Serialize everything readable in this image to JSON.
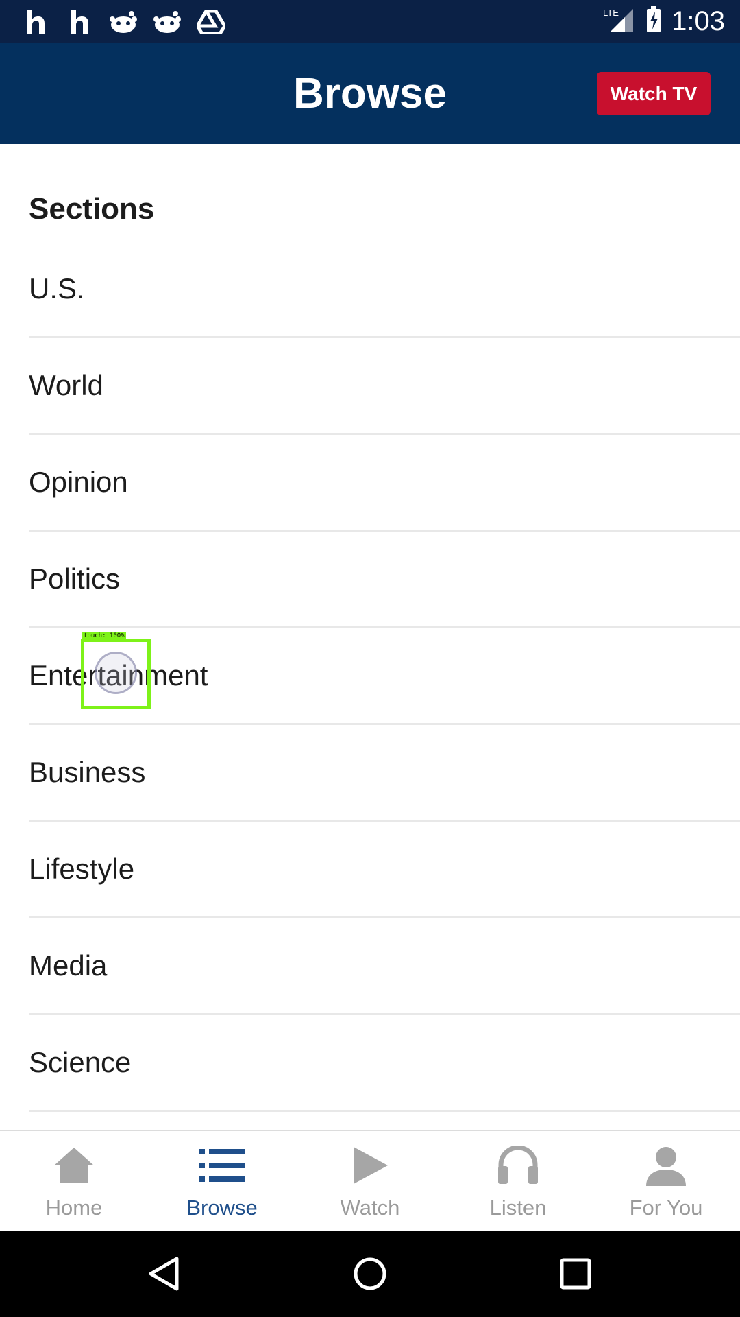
{
  "status_bar": {
    "time": "1:03",
    "network": "LTE",
    "notification_icons": [
      "h-icon",
      "h-icon",
      "reddit-icon",
      "reddit-icon",
      "drive-icon"
    ]
  },
  "app_bar": {
    "title": "Browse",
    "watch_tv_label": "Watch TV"
  },
  "sections": {
    "heading": "Sections",
    "items": [
      "U.S.",
      "World",
      "Opinion",
      "Politics",
      "Entertainment",
      "Business",
      "Lifestyle",
      "Media",
      "Science"
    ]
  },
  "touch_overlay": {
    "label": "touch: 100%"
  },
  "bottom_nav": {
    "items": [
      {
        "label": "Home",
        "icon": "home-icon",
        "active": false
      },
      {
        "label": "Browse",
        "icon": "list-icon",
        "active": true
      },
      {
        "label": "Watch",
        "icon": "play-icon",
        "active": false
      },
      {
        "label": "Listen",
        "icon": "headphones-icon",
        "active": false
      },
      {
        "label": "For You",
        "icon": "person-icon",
        "active": false
      }
    ]
  },
  "colors": {
    "status_bar": "#0b2146",
    "app_bar": "#04305e",
    "watch_tv": "#c8102e",
    "active_nav": "#1f4f8b",
    "inactive_nav": "#9a9a9a"
  }
}
